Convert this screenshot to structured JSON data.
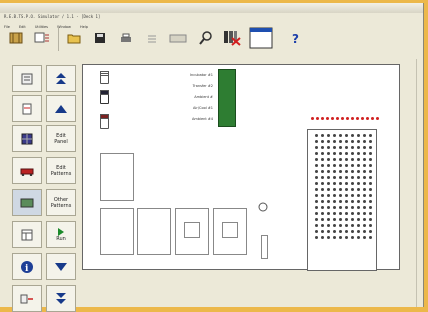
{
  "window": {
    "title": "R.E.B.TS.P.O. Simulator / 1.1 - [Deck 1]"
  },
  "menu": [
    "File",
    "Edit",
    "Utilities",
    "Window",
    "Help"
  ],
  "toolbar": {
    "items": [
      "rack-icon",
      "config-icon",
      "open-folder-icon",
      "save-icon",
      "print-icon",
      "list-icon",
      "keyboard-icon",
      "search-icon",
      "delete-rack-icon",
      "window-icon",
      "help-icon"
    ]
  },
  "sidebar": {
    "edit_panel": {
      "line1": "Edit",
      "line2": "Panel"
    },
    "edit_patterns": {
      "line1": "Edit",
      "line2": "Patterns"
    },
    "other_patterns": {
      "line1": "Other",
      "line2": "Patterns"
    },
    "run": {
      "label": "Run"
    }
  },
  "deck": {
    "slots": [
      "Incubator #1",
      "Transfer #2",
      "Ambient #",
      "Air/Cool #1",
      "Ambient #4"
    ]
  },
  "colors": {
    "accent": "#2e7d32",
    "highlight": "#d12222",
    "frame": "#ecb84a"
  }
}
